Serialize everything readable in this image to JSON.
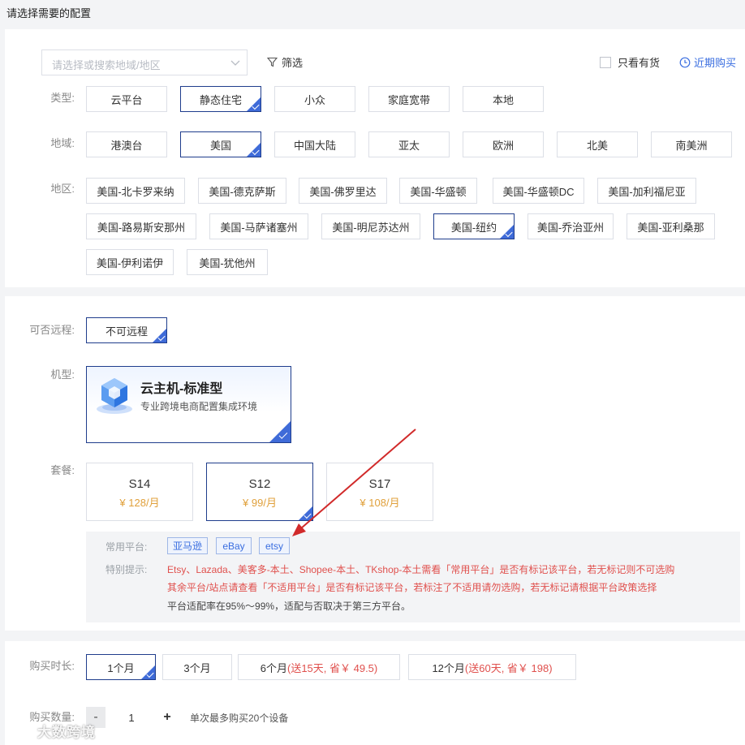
{
  "page_title": "请选择需要的配置",
  "search": {
    "placeholder": "请选择或搜索地域/地区"
  },
  "filter_label": "筛选",
  "stock_only_label": "只看有货",
  "recent_label": "近期购买",
  "type": {
    "label": "类型:",
    "options": [
      "云平台",
      "静态住宅",
      "小众",
      "家庭宽带",
      "本地"
    ],
    "selected": "静态住宅"
  },
  "region": {
    "label": "地域:",
    "options": [
      "港澳台",
      "美国",
      "中国大陆",
      "亚太",
      "欧洲",
      "北美",
      "南美洲"
    ],
    "selected": "美国"
  },
  "area": {
    "label": "地区:",
    "options": [
      "美国-北卡罗来纳",
      "美国-德克萨斯",
      "美国-佛罗里达",
      "美国-华盛顿",
      "美国-华盛顿DC",
      "美国-加利福尼亚",
      "美国-路易斯安那州",
      "美国-马萨诸塞州",
      "美国-明尼苏达州",
      "美国-纽约",
      "美国-乔治亚州",
      "美国-亚利桑那",
      "美国-伊利诺伊",
      "美国-犹他州"
    ],
    "selected": "美国-纽约"
  },
  "remote": {
    "label": "可否远程:",
    "option": "不可远程"
  },
  "machine": {
    "label": "机型:",
    "title": "云主机-标准型",
    "desc": "专业跨境电商配置集成环境",
    "icon": "cube-icon"
  },
  "plan": {
    "label": "套餐:",
    "options": [
      {
        "name": "S14",
        "price": "¥ 128/月"
      },
      {
        "name": "S12",
        "price": "¥ 99/月"
      },
      {
        "name": "S17",
        "price": "¥ 108/月"
      }
    ],
    "selected": "S12"
  },
  "platforms": {
    "label": "常用平台:",
    "tags": [
      "亚马逊",
      "eBay",
      "etsy"
    ]
  },
  "notice": {
    "label": "特别提示:",
    "line1": "Etsy、Lazada、美客多-本土、Shopee-本土、TKshop-本土需看「常用平台」是否有标记该平台，若无标记则不可选购",
    "line2": "其余平台/站点请查看「不适用平台」是否有标记该平台，若标注了不适用请勿选购，若无标记请根据平台政策选择",
    "line3": "平台适配率在95%～99%，适配与否取决于第三方平台。"
  },
  "duration": {
    "label": "购买时长:",
    "options": [
      {
        "main": "1个月",
        "extra": ""
      },
      {
        "main": "3个月",
        "extra": ""
      },
      {
        "main": "6个月",
        "extra": "(送15天, 省￥ 49.5)"
      },
      {
        "main": "12个月",
        "extra": "(送60天, 省￥ 198)"
      }
    ],
    "selected": "1个月"
  },
  "quantity": {
    "label": "购买数量:",
    "value": "1",
    "minus": "-",
    "plus": "+",
    "hint": "单次最多购买20个设备"
  },
  "watermark": "大数跨境",
  "colors": {
    "accent": "#3f6bd8",
    "selected_border": "#1f3d8c",
    "price": "#e0a03b",
    "warning": "#e0504d",
    "link": "#3a6ee0",
    "arrow": "#d12a2a"
  }
}
